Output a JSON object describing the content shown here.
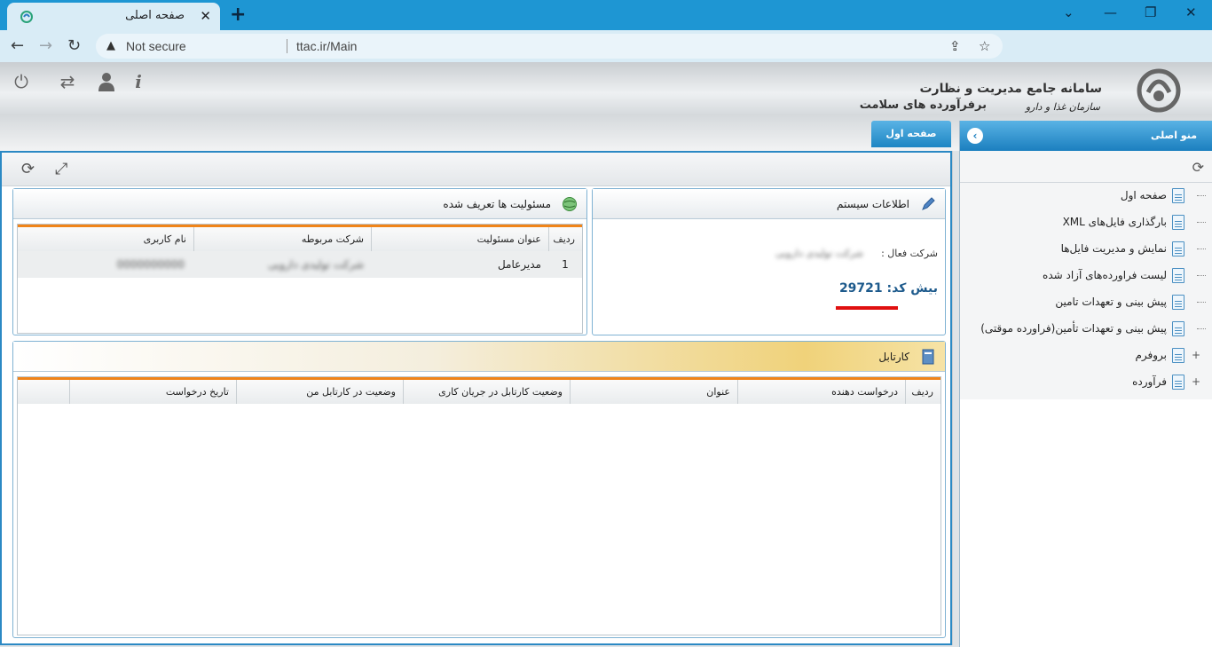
{
  "browser": {
    "tab_title": "صفحه اصلی",
    "tab_close": "✕",
    "new_tab": "+",
    "security_label": "Not secure",
    "url": "ttac.ir/Main"
  },
  "header": {
    "title_line1": "سامانه جامع مدیریت و نظارت",
    "title_line2": "برفرآورده های سلامت",
    "org_name": "سازمان غذا و دارو"
  },
  "main_tabs": [
    {
      "label": "صفحه اول"
    }
  ],
  "system_info": {
    "title": "اطلاعات سیستم",
    "active_company_label": "شرکت فعال :",
    "active_company_value": "شرکت تولیدی دارویی",
    "code_text": "بیش کد: 29721"
  },
  "responsibilities": {
    "title": "مسئولیت ها تعریف شده",
    "columns": [
      "ردیف",
      "عنوان مسئولیت",
      "شرکت مربوطه",
      "نام کاربری"
    ],
    "rows": [
      {
        "index": "1",
        "title": "مدیرعامل",
        "company": "شرکت تولیدی دارویی",
        "username": "0000000000"
      }
    ]
  },
  "kartabl": {
    "title": "کارتابل",
    "columns": [
      "ردیف",
      "درخواست دهنده",
      "عنوان",
      "وضعیت کارتابل در جریان کاری",
      "وضعیت در کارتابل من",
      "تاریخ درخواست",
      ""
    ]
  },
  "sidebar": {
    "title": "منو اصلی",
    "items": [
      {
        "label": "صفحه اول",
        "expandable": false
      },
      {
        "label": "بارگذاری فایل‌های XML",
        "expandable": false
      },
      {
        "label": "نمایش و مدیریت فایل‌ها",
        "expandable": false
      },
      {
        "label": "لیست فراورده‌های آزاد شده",
        "expandable": false
      },
      {
        "label": "پیش بینی و تعهدات تامین",
        "expandable": false
      },
      {
        "label": "پیش بینی و تعهدات تأمین(فراورده موقتی)",
        "expandable": false
      },
      {
        "label": "بروفرم",
        "expandable": true
      },
      {
        "label": "فرآورده",
        "expandable": true
      }
    ]
  },
  "colors": {
    "accent_blue": "#1e86c3",
    "grid_header_accent": "#f08419",
    "highlight_red": "#e01010",
    "code_text": "#1d5a8c"
  }
}
